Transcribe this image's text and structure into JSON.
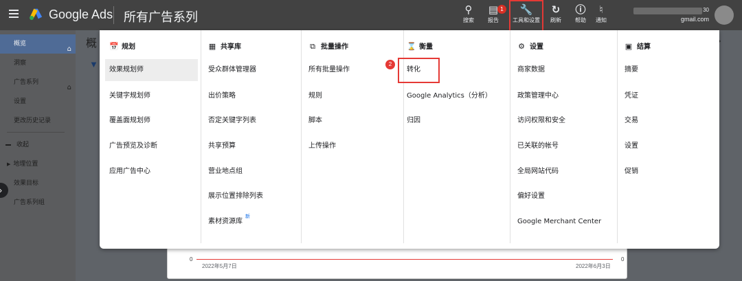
{
  "topbar": {
    "brand": "Google Ads",
    "page_title": "所有广告系列",
    "buttons": [
      {
        "label": "搜索",
        "icon": "search-icon"
      },
      {
        "label": "报告",
        "icon": "bar-chart-icon"
      },
      {
        "label": "工具和设置",
        "icon": "wrench-icon"
      },
      {
        "label": "刷新",
        "icon": "refresh-icon"
      },
      {
        "label": "帮助",
        "icon": "help-icon"
      },
      {
        "label": "通知",
        "icon": "bell-icon"
      }
    ],
    "report_badge": "1",
    "account_number": "30",
    "account_email": "gmail.com"
  },
  "sidenav": {
    "items": [
      {
        "label": "概览"
      },
      {
        "label": "洞察"
      },
      {
        "label": "广告系列"
      },
      {
        "label": "设置"
      },
      {
        "label": "更改历史记录"
      },
      {
        "label": "收起"
      },
      {
        "label": "地理位置"
      },
      {
        "label": "效果目标"
      },
      {
        "label": "广告系列组"
      }
    ]
  },
  "background": {
    "title_fragment": "概",
    "date_start": "2022年5月7日",
    "date_end": "2022年6月3日",
    "axis_zero": "0"
  },
  "menu": {
    "step_marker": "2",
    "new_label": "新",
    "columns": [
      {
        "heading": "规划",
        "icon": "calendar-icon",
        "items": [
          "效果规划师",
          "关键字规划师",
          "覆盖面规划师",
          "广告预览及诊断",
          "应用广告中心"
        ]
      },
      {
        "heading": "共享库",
        "icon": "library-icon",
        "items": [
          "受众群体管理器",
          "出价策略",
          "否定关键字列表",
          "共享预算",
          "营业地点组",
          "展示位置排除列表",
          "素材资源库"
        ]
      },
      {
        "heading": "批量操作",
        "icon": "bulk-copy-icon",
        "items": [
          "所有批量操作",
          "规则",
          "脚本",
          "上传操作"
        ]
      },
      {
        "heading": "衡量",
        "icon": "hourglass-icon",
        "items": [
          "转化",
          "Google Analytics（分析）",
          "归因"
        ]
      },
      {
        "heading": "设置",
        "icon": "settings-icon",
        "items": [
          "商家数据",
          "政策管理中心",
          "访问权限和安全",
          "已关联的帐号",
          "全局网站代码",
          "偏好设置",
          "Google Merchant Center"
        ]
      },
      {
        "heading": "结算",
        "icon": "credit-card-icon",
        "items": [
          "摘要",
          "凭证",
          "交易",
          "设置",
          "促销"
        ]
      }
    ]
  }
}
